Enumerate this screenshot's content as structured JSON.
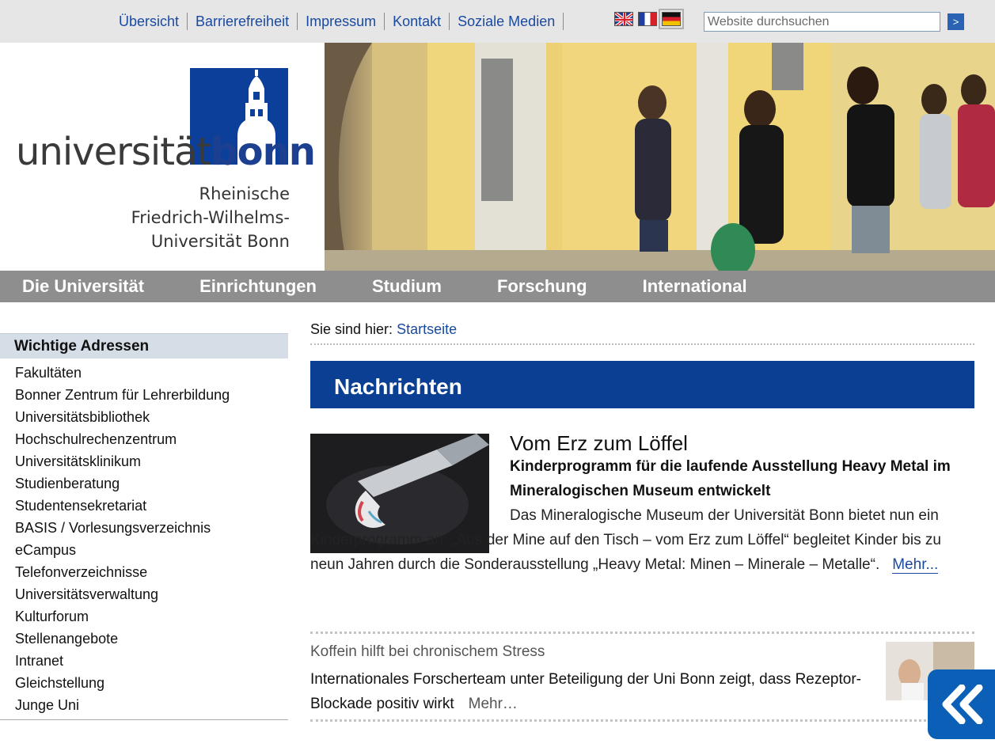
{
  "top_links": [
    "Übersicht",
    "Barrierefreiheit",
    "Impressum",
    "Kontakt",
    "Soziale Medien"
  ],
  "languages": [
    {
      "name": "english-flag-icon",
      "active": false
    },
    {
      "name": "french-flag-icon",
      "active": false
    },
    {
      "name": "german-flag-icon",
      "active": true
    }
  ],
  "search": {
    "placeholder": "Website durchsuchen",
    "button_label": ">"
  },
  "logo": {
    "wordmark_regular": "universität",
    "wordmark_bold": "bonn",
    "subtitle_lines": [
      "Rheinische",
      "Friedrich-Wilhelms-",
      "Universität Bonn"
    ],
    "brand_color": "#0b3f9a"
  },
  "main_nav": [
    "Die Universität",
    "Einrichtungen",
    "Studium",
    "Forschung",
    "International"
  ],
  "sidebar": {
    "title": "Wichtige Adressen",
    "items": [
      "Fakultäten",
      "Bonner Zentrum für Lehrerbildung",
      "Universitätsbibliothek",
      "Hochschulrechenzentrum",
      "Universitätsklinikum",
      "Studienberatung",
      "Studentensekretariat",
      "BASIS / Vorlesungsverzeichnis",
      "eCampus",
      "Telefonverzeichnisse",
      "Universitätsverwaltung",
      "Kulturforum",
      "Stellenangebote",
      "Intranet",
      "Gleichstellung",
      "Junge Uni"
    ]
  },
  "breadcrumb": {
    "prefix": "Sie sind hier:",
    "current": "Startseite"
  },
  "news": {
    "heading": "Nachrichten",
    "articles": [
      {
        "title": "Vom Erz zum Löffel",
        "lead": "Kinderprogramm für die laufende Ausstellung Heavy Metal im Mineralogischen Museum entwickelt",
        "body": "Das Mineralogische Museum der Universität Bonn bietet nun ein Kinderprogramm an: „Aus der Mine auf den Tisch – vom Erz zum Löffel“ begleitet Kinder bis zu neun Jahren durch die Sonderausstellung „Heavy Metal: Minen – Minerale – Metalle“.",
        "more": "Mehr..."
      },
      {
        "title": "Koffein hilft bei chronischem Stress",
        "body": "Internationales Forscherteam unter Beteiligung der Uni Bonn zeigt, dass Rezeptor-Blockade positiv wirkt",
        "more": "Mehr…"
      }
    ]
  },
  "colors": {
    "nav_gray": "#8e8e8e",
    "news_banner": "#0a3f93",
    "link_blue": "#1a4aa0",
    "sidebar_header": "#d5dde6"
  }
}
